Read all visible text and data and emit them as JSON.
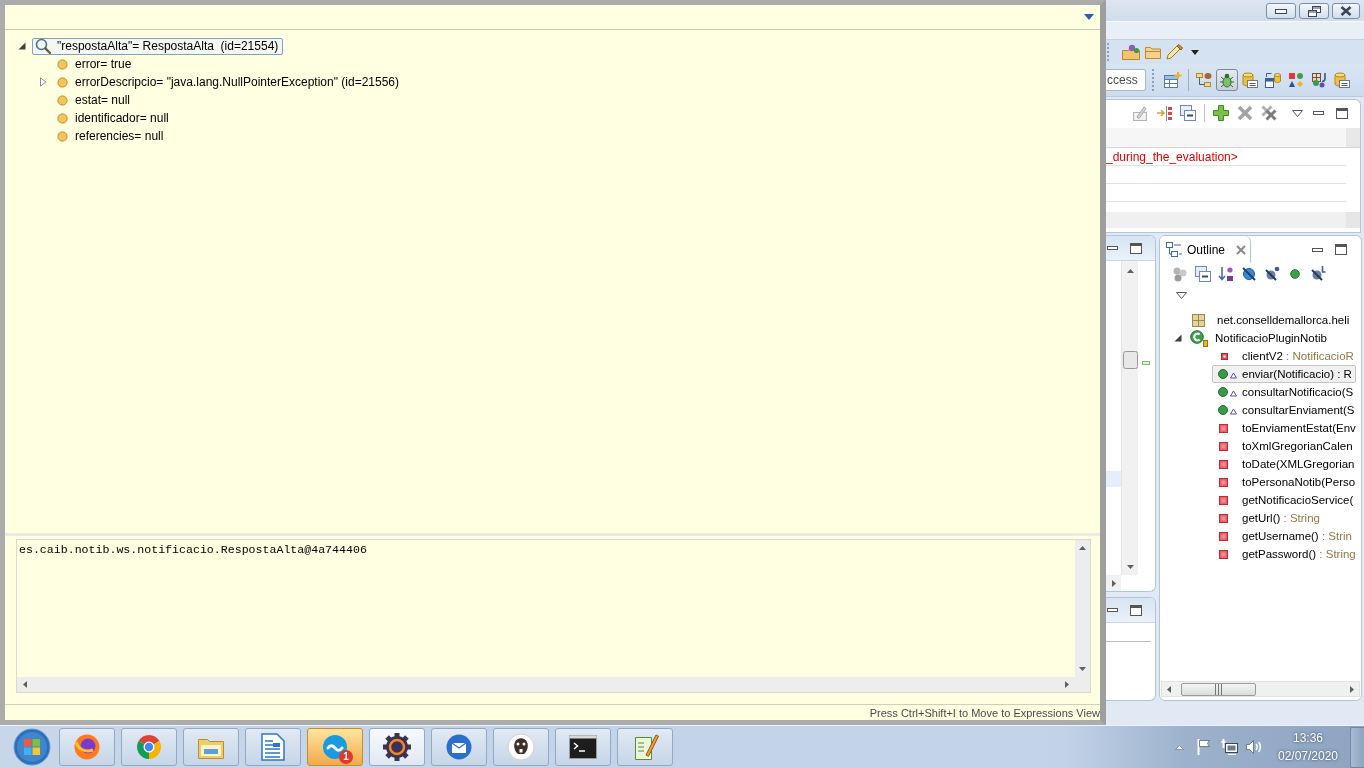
{
  "inspect_popup": {
    "tree": [
      {
        "label": "\"respostaAlta\"= RespostaAlta  (id=21554)",
        "expandable": true,
        "expanded": true,
        "selected": true,
        "children": [
          {
            "label": "error= true",
            "expandable": false,
            "selected": false
          },
          {
            "label": "errorDescripcio= \"java.lang.NullPointerException\" (id=21556)",
            "expandable": true,
            "expanded": false,
            "selected": false
          },
          {
            "label": "estat= null",
            "expandable": false,
            "selected": false
          },
          {
            "label": "identificador= null",
            "expandable": false,
            "selected": false
          },
          {
            "label": "referencies= null",
            "expandable": false,
            "selected": false
          }
        ]
      }
    ],
    "detail_text": "es.caib.notib.ws.notificacio.RespostaAlta@4a744406",
    "hint": "Press Ctrl+Shift+I to Move to Expressions View"
  },
  "ide_window": {
    "quick_access": {
      "placeholder": "ccess"
    },
    "perspectives": [
      {
        "selected": false
      },
      {
        "selected": true
      },
      {
        "selected": false
      },
      {
        "selected": false
      },
      {
        "selected": false
      },
      {
        "selected": false
      },
      {
        "selected": false
      }
    ],
    "variables_table": {
      "rows": [
        {
          "column_1": "_during_the_evaluation>",
          "error": true
        }
      ]
    },
    "outline": {
      "tab": "Outline",
      "tree": [
        {
          "kind": "package",
          "label": "net.conselldemallorca.heli",
          "expandable": false,
          "selected": false
        },
        {
          "kind": "class",
          "label": "NotificacioPluginNotib",
          "expandable": true,
          "expanded": true,
          "selected": false,
          "children": [
            {
              "kind": "field",
              "label": "clientV2",
              "return_type": " : NotificacioR",
              "expandable": false,
              "selected": false
            },
            {
              "kind": "public",
              "label": "enviar(Notificacio) : R",
              "expandable": false,
              "selected": true
            },
            {
              "kind": "public",
              "label": "consultarNotificacio(S",
              "expandable": false,
              "selected": false
            },
            {
              "kind": "public",
              "label": "consultarEnviament(S",
              "expandable": false,
              "selected": false
            },
            {
              "kind": "private",
              "label": "toEnviamentEstat(Env",
              "expandable": false,
              "selected": false
            },
            {
              "kind": "private",
              "label": "toXmlGregorianCalen",
              "expandable": false,
              "selected": false
            },
            {
              "kind": "private",
              "label": "toDate(XMLGregorian",
              "expandable": false,
              "selected": false
            },
            {
              "kind": "private",
              "label": "toPersonaNotib(Perso",
              "expandable": false,
              "selected": false
            },
            {
              "kind": "private",
              "label": "getNotificacioService(",
              "expandable": false,
              "selected": false
            },
            {
              "kind": "private",
              "label": "getUrl()",
              "return_type": " : String",
              "expandable": false,
              "selected": false
            },
            {
              "kind": "private",
              "label": "getUsername()",
              "return_type": " : Strin",
              "expandable": false,
              "selected": false
            },
            {
              "kind": "private",
              "label": "getPassword()",
              "return_type": " : String",
              "expandable": false,
              "selected": false
            }
          ]
        }
      ]
    }
  },
  "taskbar": {
    "apps": [
      {
        "active": false,
        "flashing": false
      },
      {
        "active": false,
        "flashing": false
      },
      {
        "active": false,
        "flashing": false
      },
      {
        "active": false,
        "flashing": false
      },
      {
        "active": false,
        "flashing": true,
        "badge": "1"
      },
      {
        "active": true,
        "flashing": false
      },
      {
        "active": false,
        "flashing": false
      },
      {
        "active": false,
        "flashing": false
      },
      {
        "active": false,
        "flashing": false
      },
      {
        "active": false,
        "flashing": false
      }
    ],
    "clock": {
      "time": "13:36",
      "date": "02/07/2020"
    }
  }
}
